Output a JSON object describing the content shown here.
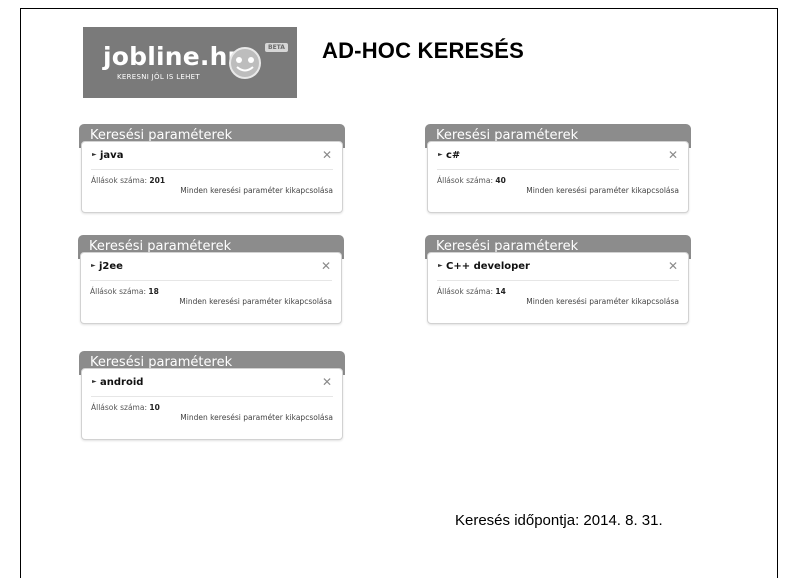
{
  "title": "AD-HOC KERESÉS",
  "logo": {
    "text": "jobline.hu",
    "tagline": "KERESNI JÓL IS LEHET",
    "badge": "BETA"
  },
  "cards": [
    {
      "header": "Keresési paraméterek",
      "term": "java",
      "count_label": "Állások száma:",
      "count": "201",
      "deactivate": "Minden keresési paraméter kikapcsolása"
    },
    {
      "header": "Keresési paraméterek",
      "term": "c#",
      "count_label": "Állások száma:",
      "count": "40",
      "deactivate": "Minden keresési paraméter kikapcsolása"
    },
    {
      "header": "Keresési paraméterek",
      "term": "j2ee",
      "count_label": "Állások száma:",
      "count": "18",
      "deactivate": "Minden keresési paraméter kikapcsolása"
    },
    {
      "header": "Keresési paraméterek",
      "term": "C++ developer",
      "count_label": "Állások száma:",
      "count": "14",
      "deactivate": "Minden keresési paraméter kikapcsolása"
    },
    {
      "header": "Keresési paraméterek",
      "term": "android",
      "count_label": "Állások száma:",
      "count": "10",
      "deactivate": "Minden keresési paraméter kikapcsolása"
    }
  ],
  "footer": {
    "timestamp": "Keresés időpontja: 2014. 8. 31."
  },
  "icons": {
    "close": "close-icon",
    "bullet": "bullet-arrow-icon"
  },
  "colors": {
    "header_bg": "#8c8c8c",
    "logo_bg": "#7a7a7a"
  }
}
